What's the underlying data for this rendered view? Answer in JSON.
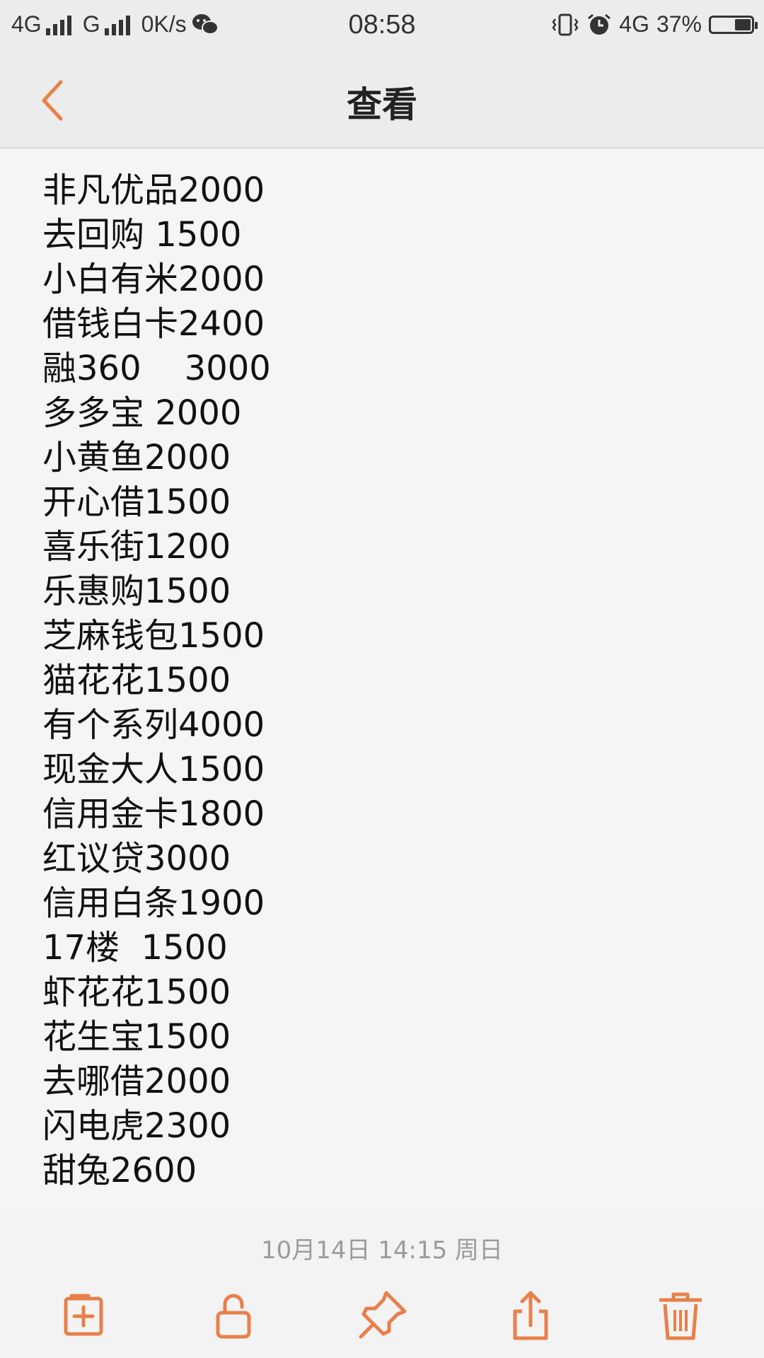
{
  "status_bar": {
    "network1": "4G",
    "network2": "G",
    "speed": "0K/s",
    "time": "08:58",
    "network3": "4G",
    "battery": "37%"
  },
  "header": {
    "title": "查看"
  },
  "note": {
    "lines": [
      "非凡优品2000",
      "去回购 1500",
      "小白有米2000",
      "借钱白卡2400",
      "融360    3000",
      "多多宝 2000",
      "小黄鱼2000",
      "开心借1500",
      "喜乐街1200",
      "乐惠购1500",
      "芝麻钱包1500",
      "猫花花1500",
      "有个系列4000",
      "现金大人1500",
      "信用金卡1800",
      "红议贷3000",
      "信用白条1900",
      "17楼  1500",
      "虾花花1500",
      "花生宝1500",
      "去哪借2000",
      "闪电虎2300",
      "甜兔2600"
    ]
  },
  "footer": {
    "date": "10月14日 14:15 周日"
  },
  "toolbar": {
    "icons": [
      "new-note-icon",
      "unlock-icon",
      "pin-icon",
      "share-icon",
      "trash-icon"
    ]
  },
  "colors": {
    "accent": "#e8804a",
    "background": "#f5f5f4",
    "bar": "#ececec"
  }
}
